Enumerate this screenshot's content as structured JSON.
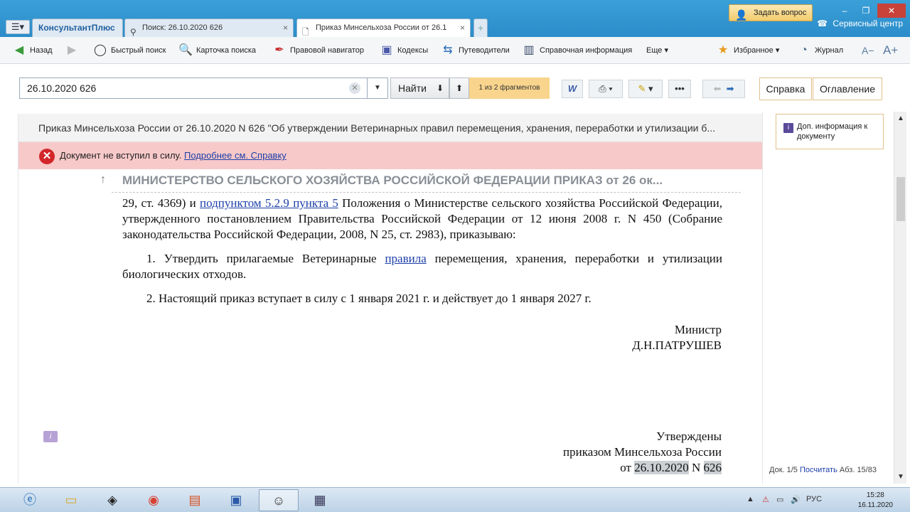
{
  "titlebar": {
    "brand": "КонсультантПлюс",
    "tabs": [
      {
        "label": "Поиск: 26.10.2020 626"
      },
      {
        "label": "Приказ Минсельхоза России от 26.1"
      }
    ],
    "ask_question": "Задать вопрос",
    "service_center": "Сервисный центр"
  },
  "toolbar": {
    "back": "Назад",
    "quick_search": "Быстрый поиск",
    "search_card": "Карточка поиска",
    "legal_navigator": "Правовой навигатор",
    "codes": "Кодексы",
    "guides": "Путеводители",
    "reference_info": "Справочная информация",
    "more": "Еще",
    "favorites": "Избранное",
    "journal": "Журнал",
    "font_decrease": "A−",
    "font_increase": "A+"
  },
  "search": {
    "value": "26.10.2020 626",
    "find_label": "Найти",
    "fragments": "1 из 2 фрагментов",
    "help": "Справка",
    "toc": "Оглавление"
  },
  "document": {
    "header": "Приказ Минсельхоза России от 26.10.2020 N 626 \"Об утверждении Ветеринарных правил перемещения, хранения, переработки и утилизации б...",
    "status_text": "Документ не вступил в силу.",
    "status_link": "Подробнее см. Справку",
    "heading": "МИНИСТЕРСТВО СЕЛЬСКОГО ХОЗЯЙСТВА РОССИЙСКОЙ ФЕДЕРАЦИИ ПРИКАЗ от 26 ок...",
    "para1_pre": "29, ст. 4369) и ",
    "para1_link": "подпунктом 5.2.9 пункта 5",
    "para1_post": " Положения о Министерстве сельского хозяйства Российской Федерации, утвержденного постановлением Правительства Российской Федерации от 12 июня 2008 г. N 450 (Собрание законодательства Российской Федерации, 2008, N 25, ст. 2983), приказываю:",
    "item1_pre": "1. Утвердить прилагаемые Ветеринарные ",
    "item1_link": "правила",
    "item1_post": " перемещения, хранения, переработки и утилизации биологических отходов.",
    "item2": "2. Настоящий приказ вступает в силу с 1 января 2021 г. и действует до 1 января 2027 г.",
    "signer_title": "Министр",
    "signer_name": "Д.Н.ПАТРУШЕВ",
    "approved": "Утверждены",
    "approved_by": "приказом Минсельхоза России",
    "approved_from": "от",
    "approved_date_1": "26.",
    "approved_date_2": "10.",
    "approved_date_3": "2020",
    "approved_n": "N",
    "approved_number": "626"
  },
  "right_panel": {
    "extra_info": "Доп. информация к документу",
    "doc_label": "Док. 1/5",
    "count_link": "Посчитать",
    "paragraph": "Абз. 15/83"
  },
  "taskbar": {
    "language": "РУС",
    "time": "15:28",
    "date": "16.11.2020"
  }
}
